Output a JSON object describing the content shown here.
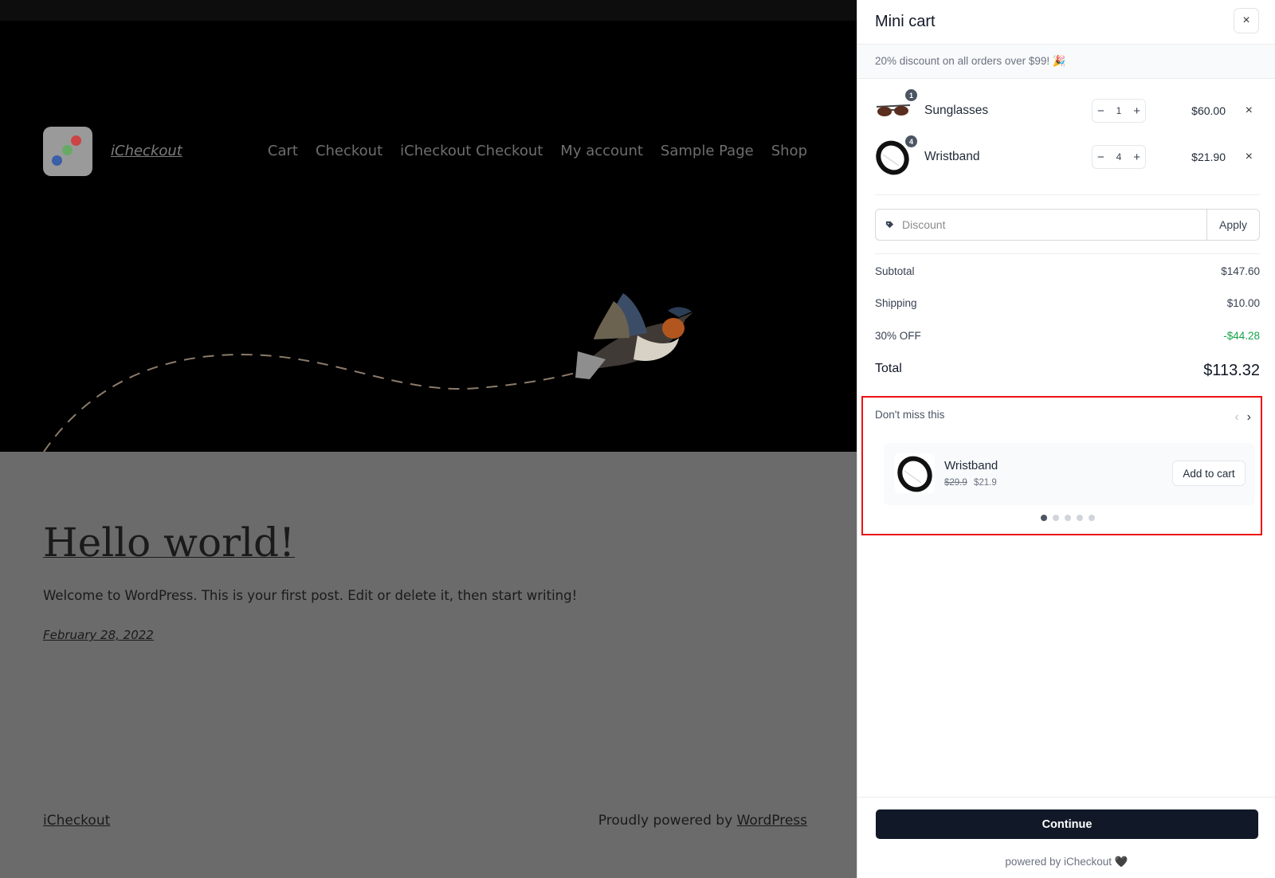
{
  "site": {
    "title": "iCheckout",
    "nav": [
      "Cart",
      "Checkout",
      "iCheckout Checkout",
      "My account",
      "Sample Page",
      "Shop"
    ],
    "post_title": "Hello world!",
    "post_body": "Welcome to WordPress. This is your first post. Edit or delete it, then start writing!",
    "post_date": "February 28, 2022",
    "footer_brand": "iCheckout",
    "footer_powered_prefix": "Proudly powered by ",
    "footer_powered_link": "WordPress"
  },
  "cart": {
    "title": "Mini cart",
    "close_icon": "×",
    "promo": "20% discount on all orders over $99! 🎉",
    "items": [
      {
        "name": "Sunglasses",
        "badge": "1",
        "qty": "1",
        "price": "$60.00",
        "minus": "−",
        "plus": "+",
        "remove": "×"
      },
      {
        "name": "Wristband",
        "badge": "4",
        "qty": "4",
        "price": "$21.90",
        "minus": "−",
        "plus": "+",
        "remove": "×"
      }
    ],
    "discount": {
      "placeholder": "Discount",
      "apply_label": "Apply"
    },
    "summary": {
      "subtotal_label": "Subtotal",
      "subtotal_value": "$147.60",
      "shipping_label": "Shipping",
      "shipping_value": "$10.00",
      "discount_label": "30% OFF",
      "discount_value": "-$44.28",
      "total_label": "Total",
      "total_value": "$113.32"
    },
    "upsell": {
      "title": "Don't miss this",
      "prev_icon": "‹",
      "next_icon": "›",
      "product_name": "Wristband",
      "old_price": "$29.9",
      "new_price": "$21.9",
      "add_label": "Add to cart",
      "dots_count": 5,
      "active_dot": 0
    },
    "continue_label": "Continue",
    "powered_label": "powered by iCheckout 🖤"
  },
  "colors": {
    "accent_dark": "#111827",
    "discount_green": "#16a34a",
    "highlight_red": "#ee1111"
  }
}
